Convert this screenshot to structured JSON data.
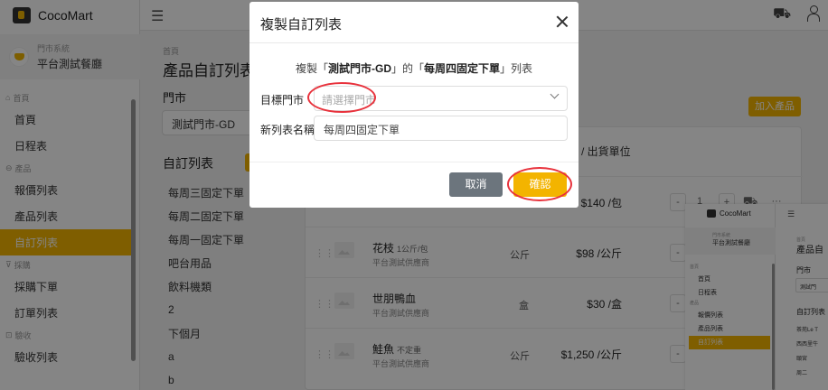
{
  "app": {
    "name": "CocoMart"
  },
  "sidebar": {
    "store_system": "門市系統",
    "store_name": "平台測試餐廳",
    "groups": [
      {
        "label": "首頁",
        "items": [
          "首頁",
          "日程表"
        ]
      },
      {
        "label": "產品",
        "items": [
          "報價列表",
          "產品列表",
          "自訂列表"
        ]
      },
      {
        "label": "採購",
        "items": [
          "採購下單",
          "訂單列表"
        ]
      },
      {
        "label": "驗收",
        "items": [
          "驗收列表"
        ]
      }
    ],
    "active_item": "自訂列表"
  },
  "main": {
    "breadcrumb": "首頁",
    "page_title": "產品自訂列表",
    "store_label": "門市",
    "store_selected": "測試門市-GD",
    "list_title": "自訂列表",
    "lists": [
      "每周三固定下單",
      "每周二固定下單",
      "每周一固定下單",
      "吧台用品",
      "飲料機類",
      "2",
      "下個月",
      "a",
      "b"
    ],
    "add_product": "加入產品",
    "table_header_unit": "/ 出貨單位",
    "rows": [
      {
        "name": "",
        "size": "",
        "supplier": "",
        "unit": "",
        "price": "$140 /包",
        "qty": "1"
      },
      {
        "name": "花枝",
        "size": "1公斤/包",
        "supplier": "平台測試供應商",
        "unit": "公斤",
        "price": "$98 /公斤"
      },
      {
        "name": "世朋鴨血",
        "size": "",
        "supplier": "平台測試供應商",
        "unit": "盒",
        "price": "$30 /盒"
      },
      {
        "name": "鮭魚",
        "size": "不定重",
        "supplier": "平台測試供應商",
        "unit": "公斤",
        "price": "$1,250 /公斤"
      }
    ]
  },
  "preview": {
    "logo": "CocoMart",
    "store_system": "門市系統",
    "store_name": "平台測試餐廳",
    "nav_group1": "首頁",
    "nav_items1": [
      "首頁",
      "日程表"
    ],
    "nav_group2": "產品",
    "nav_items2": [
      "報價列表",
      "產品列表",
      "自訂列表"
    ],
    "crumb": "首頁",
    "title": "產品自",
    "store_label": "門市",
    "store_sel": "測試門",
    "list_title": "自訂列表",
    "lists": [
      "茶苑Le T",
      "西西里牛",
      "頤宮",
      "周二"
    ]
  },
  "modal": {
    "title": "複製自訂列表",
    "desc_prefix": "複製「",
    "desc_store": "測試門市-GD",
    "desc_mid": "」的「",
    "desc_list": "每周四固定下單",
    "desc_suffix": "」列表",
    "target_label": "目標門市",
    "target_placeholder": "請選擇門市",
    "name_label": "新列表名稱",
    "name_value": "每周四固定下單",
    "cancel": "取消",
    "confirm": "確認"
  },
  "colors": {
    "accent": "#f3b400",
    "cancel": "#6c757d",
    "annotation": "#e8323c"
  }
}
